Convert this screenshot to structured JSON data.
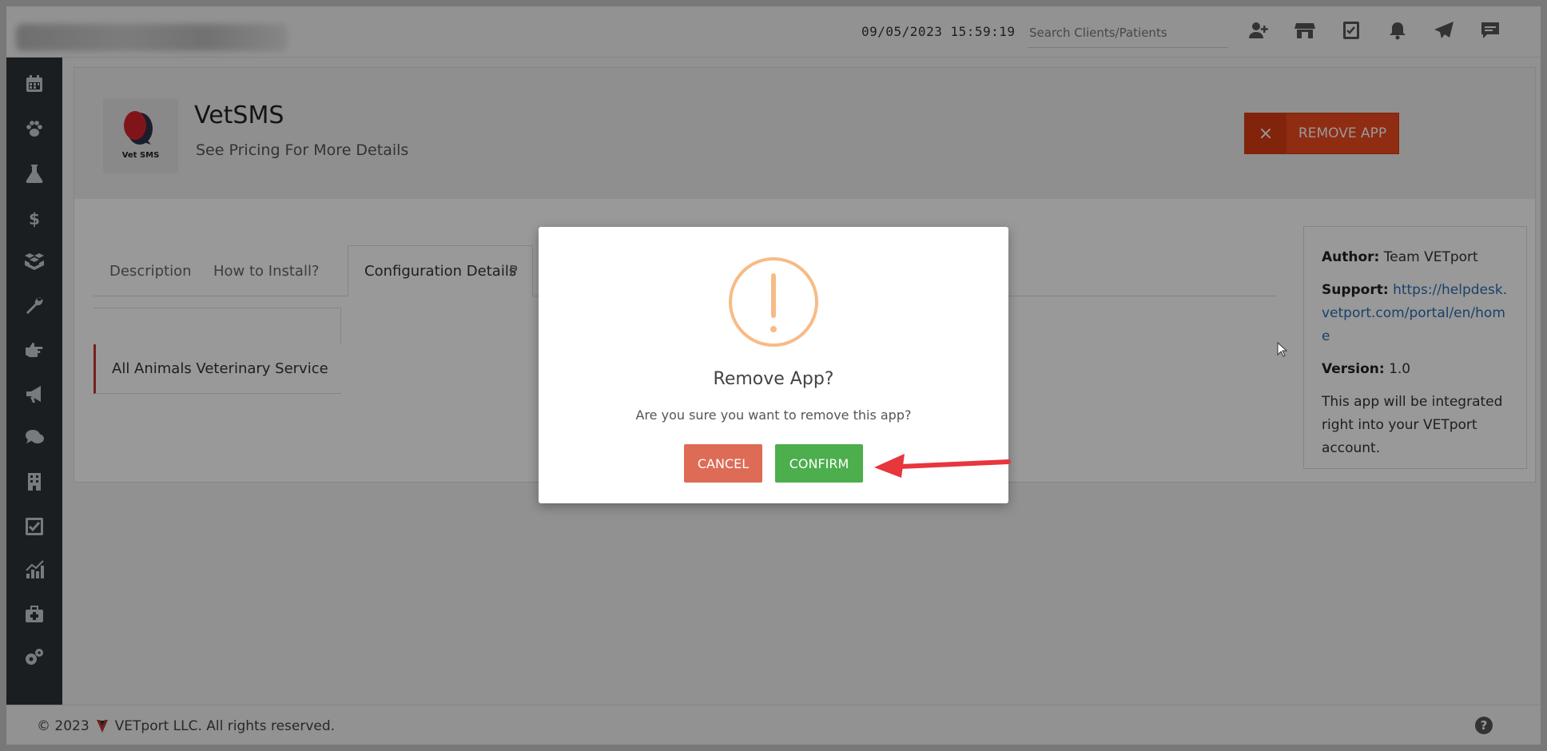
{
  "topbar": {
    "datetime": "09/05/2023 15:59:19",
    "search_placeholder": "Search Clients/Patients",
    "icons": [
      "add-user-icon",
      "store-icon",
      "checkbox-icon",
      "bell-icon",
      "send-icon",
      "chat-icon"
    ]
  },
  "sidebar": {
    "icons": [
      "calendar-icon",
      "paw-icon",
      "flask-icon",
      "dollar-icon",
      "boxes-icon",
      "wrench-icon",
      "hand-point-icon",
      "megaphone-icon",
      "comments-icon",
      "building-icon",
      "checklist-icon",
      "chart-icon",
      "medkit-icon",
      "settings-icon"
    ]
  },
  "app": {
    "logo_text": "Vet SMS",
    "name": "VetSMS",
    "subtitle": "See Pricing For More Details",
    "remove_button": "REMOVE APP",
    "remove_icon": "×"
  },
  "tabs": {
    "description": "Description",
    "how_to_install": "How to Install?",
    "configuration": "Configuration Details",
    "partial": "P"
  },
  "list": {
    "item": "All Animals Veterinary Service"
  },
  "info": {
    "author_label": "Author:",
    "author": "Team VETport",
    "support_label": "Support:",
    "support_link": "https://helpdesk.vetport.com/portal/en/home",
    "version_label": "Version:",
    "version": "1.0",
    "description": "This app will be integrated right into your VETport account."
  },
  "footer": {
    "copyright": "© 2023",
    "company": "VETport LLC. All rights reserved.",
    "help": "?"
  },
  "modal": {
    "title": "Remove App?",
    "message": "Are you sure you want to remove this app?",
    "cancel": "CANCEL",
    "confirm": "CONFIRM"
  },
  "colors": {
    "accent_remove": "#ef4a1e",
    "cancel": "#dd6b55",
    "confirm": "#4cae4c",
    "warning": "#f8bb86",
    "arrow": "#e8363d"
  }
}
